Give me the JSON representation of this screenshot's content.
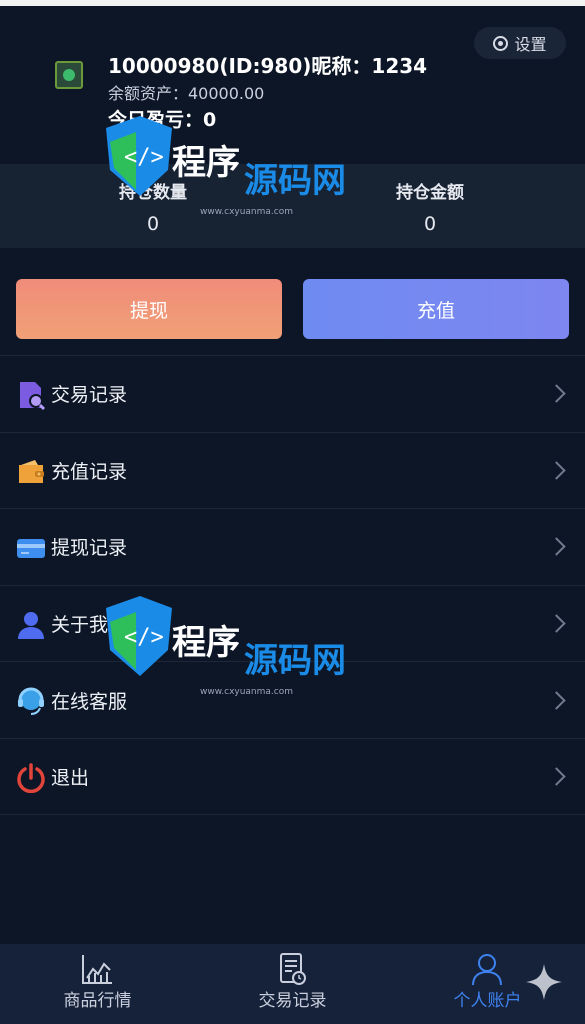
{
  "header": {
    "user_line": "10000980(ID:980)昵称：1234",
    "balance": "余额资产：40000.00",
    "today_pnl": "今日盈亏：0",
    "settings_label": "设置"
  },
  "stats": {
    "position_qty_label": "持仓数量",
    "position_qty_value": "0",
    "position_amount_label": "持仓金额",
    "position_amount_value": "0"
  },
  "actions": {
    "withdraw_label": "提现",
    "deposit_label": "充值"
  },
  "menu": [
    {
      "label": "交易记录",
      "icon": "trade-record-icon",
      "color": "#7b5ce0"
    },
    {
      "label": "充值记录",
      "icon": "wallet-icon",
      "color": "#f0a23a"
    },
    {
      "label": "提现记录",
      "icon": "card-icon",
      "color": "#3e8ef0"
    },
    {
      "label": "关于我们",
      "icon": "user-icon",
      "color": "#4f6cf0"
    },
    {
      "label": "在线客服",
      "icon": "headset-icon",
      "color": "#3aa0e8"
    },
    {
      "label": "退出",
      "icon": "power-icon",
      "color": "#e0443a"
    }
  ],
  "tabbar": [
    {
      "label": "商品行情",
      "icon": "chart-icon",
      "active": false
    },
    {
      "label": "交易记录",
      "icon": "document-icon",
      "active": false
    },
    {
      "label": "个人账户",
      "icon": "person-icon",
      "active": true
    }
  ],
  "watermark": {
    "title_white": "程序",
    "title_blue": "源码网",
    "url": "www.cxyuanma.com"
  },
  "colors": {
    "background": "#0d1626",
    "stats_background": "#172233",
    "accent": "#3e82ef"
  }
}
